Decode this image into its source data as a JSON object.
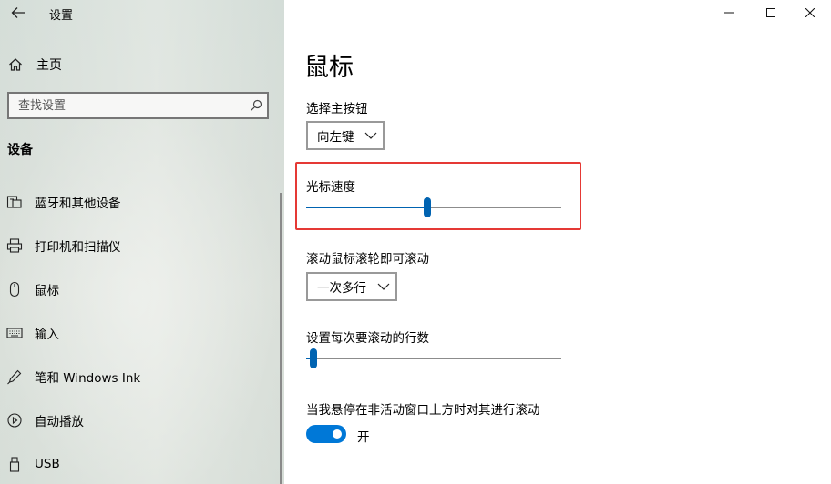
{
  "app": {
    "title": "设置",
    "window_controls": [
      "minimize",
      "maximize",
      "close"
    ]
  },
  "nav": {
    "home_label": "主页",
    "search_placeholder": "查找设置",
    "section_title": "设备",
    "items": [
      {
        "label": "蓝牙和其他设备",
        "icon": "bluetooth-devices-icon"
      },
      {
        "label": "打印机和扫描仪",
        "icon": "printer-icon"
      },
      {
        "label": "鼠标",
        "icon": "mouse-icon"
      },
      {
        "label": "输入",
        "icon": "keyboard-icon"
      },
      {
        "label": "笔和 Windows Ink",
        "icon": "pen-icon"
      },
      {
        "label": "自动播放",
        "icon": "autoplay-icon"
      },
      {
        "label": "USB",
        "icon": "usb-icon"
      }
    ]
  },
  "main": {
    "page_title": "鼠标",
    "primary_button": {
      "label": "选择主按钮",
      "value": "向左键"
    },
    "cursor_speed": {
      "label": "光标速度",
      "value_fraction": 0.475
    },
    "scroll_wheel": {
      "label": "滚动鼠标滚轮即可滚动",
      "value": "一次多行"
    },
    "lines_to_scroll": {
      "label": "设置每次要滚动的行数",
      "value_fraction": 0.03
    },
    "inactive_scroll": {
      "label": "当我悬停在非活动窗口上方时对其进行滚动",
      "state": "开",
      "on": true
    }
  },
  "colors": {
    "accent": "#0078d7",
    "slider_fill": "#0063b1",
    "highlight_border": "#e53935"
  }
}
